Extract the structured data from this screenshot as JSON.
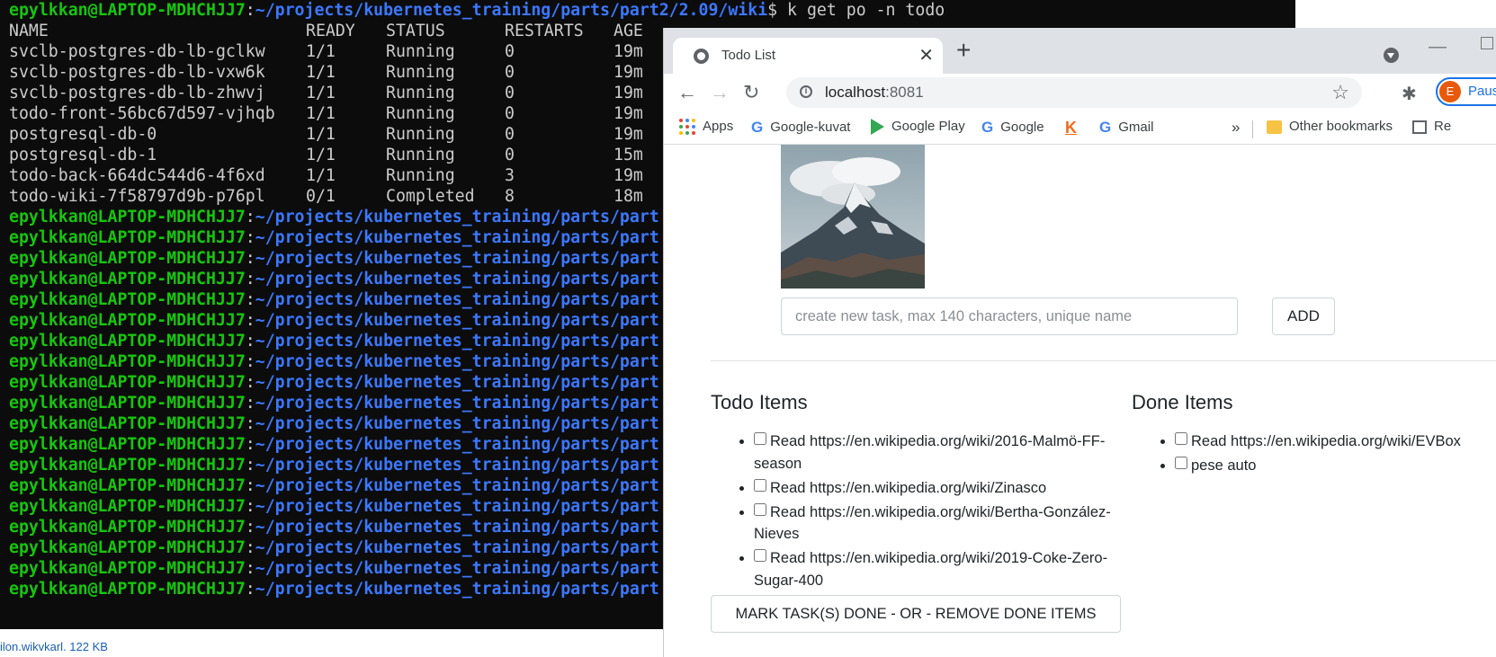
{
  "terminal": {
    "prompt_user": "epylkkan@LAPTOP-MDHCHJJ7",
    "command_path": "~/projects/kubernetes_training/parts/part2/2.09/wiki",
    "command": "$ k get po -n todo",
    "headers": [
      "NAME",
      "READY",
      "STATUS",
      "RESTARTS",
      "AGE"
    ],
    "pods": [
      {
        "name": "svclb-postgres-db-lb-gclkw",
        "ready": "1/1",
        "status": "Running",
        "restarts": "0",
        "age": "19m"
      },
      {
        "name": "svclb-postgres-db-lb-vxw6k",
        "ready": "1/1",
        "status": "Running",
        "restarts": "0",
        "age": "19m"
      },
      {
        "name": "svclb-postgres-db-lb-zhwvj",
        "ready": "1/1",
        "status": "Running",
        "restarts": "0",
        "age": "19m"
      },
      {
        "name": "todo-front-56bc67d597-vjhqb",
        "ready": "1/1",
        "status": "Running",
        "restarts": "0",
        "age": "19m"
      },
      {
        "name": "postgresql-db-0",
        "ready": "1/1",
        "status": "Running",
        "restarts": "0",
        "age": "19m"
      },
      {
        "name": "postgresql-db-1",
        "ready": "1/1",
        "status": "Running",
        "restarts": "0",
        "age": "15m"
      },
      {
        "name": "todo-back-664dc544d6-4f6xd",
        "ready": "1/1",
        "status": "Running",
        "restarts": "3",
        "age": "19m"
      },
      {
        "name": "todo-wiki-7f58797d9b-p76pl",
        "ready": "0/1",
        "status": "Completed",
        "restarts": "8",
        "age": "18m"
      }
    ],
    "prompt_path_truncated": "~/projects/kubernetes_training/parts/part",
    "prompt_repeat_count": 19
  },
  "bottom_strip": {
    "text": "ilon.wikvkarl. 122 KB"
  },
  "browser": {
    "tab_title": "Todo List",
    "url_host": "localhost",
    "url_port": ":8081",
    "profile_initial": "E",
    "profile_label": "Paus",
    "bookmarks": {
      "apps": "Apps",
      "google_kuvat": "Google-kuvat",
      "google_play": "Google Play",
      "google": "Google",
      "gmail": "Gmail",
      "overflow": "»",
      "other": "Other bookmarks",
      "reading": "Re"
    }
  },
  "page": {
    "input_placeholder": "create new task, max 140 characters, unique name",
    "add_label": "ADD",
    "todo_title": "Todo Items",
    "done_title": "Done Items",
    "todo_items": [
      "Read https://en.wikipedia.org/wiki/2016-Malmö-FF-season",
      "Read https://en.wikipedia.org/wiki/Zinasco",
      "Read https://en.wikipedia.org/wiki/Bertha-González-Nieves",
      "Read https://en.wikipedia.org/wiki/2019-Coke-Zero-Sugar-400"
    ],
    "done_items": [
      "Read https://en.wikipedia.org/wiki/EVBox",
      "pese auto"
    ],
    "mark_button": "MARK TASK(S) DONE - OR - REMOVE DONE ITEMS"
  },
  "colors": {
    "terminal_bg": "#0c0c0c",
    "prompt_user": "#16c60c",
    "prompt_path": "#3b78ff",
    "accent": "#1a73e8"
  }
}
